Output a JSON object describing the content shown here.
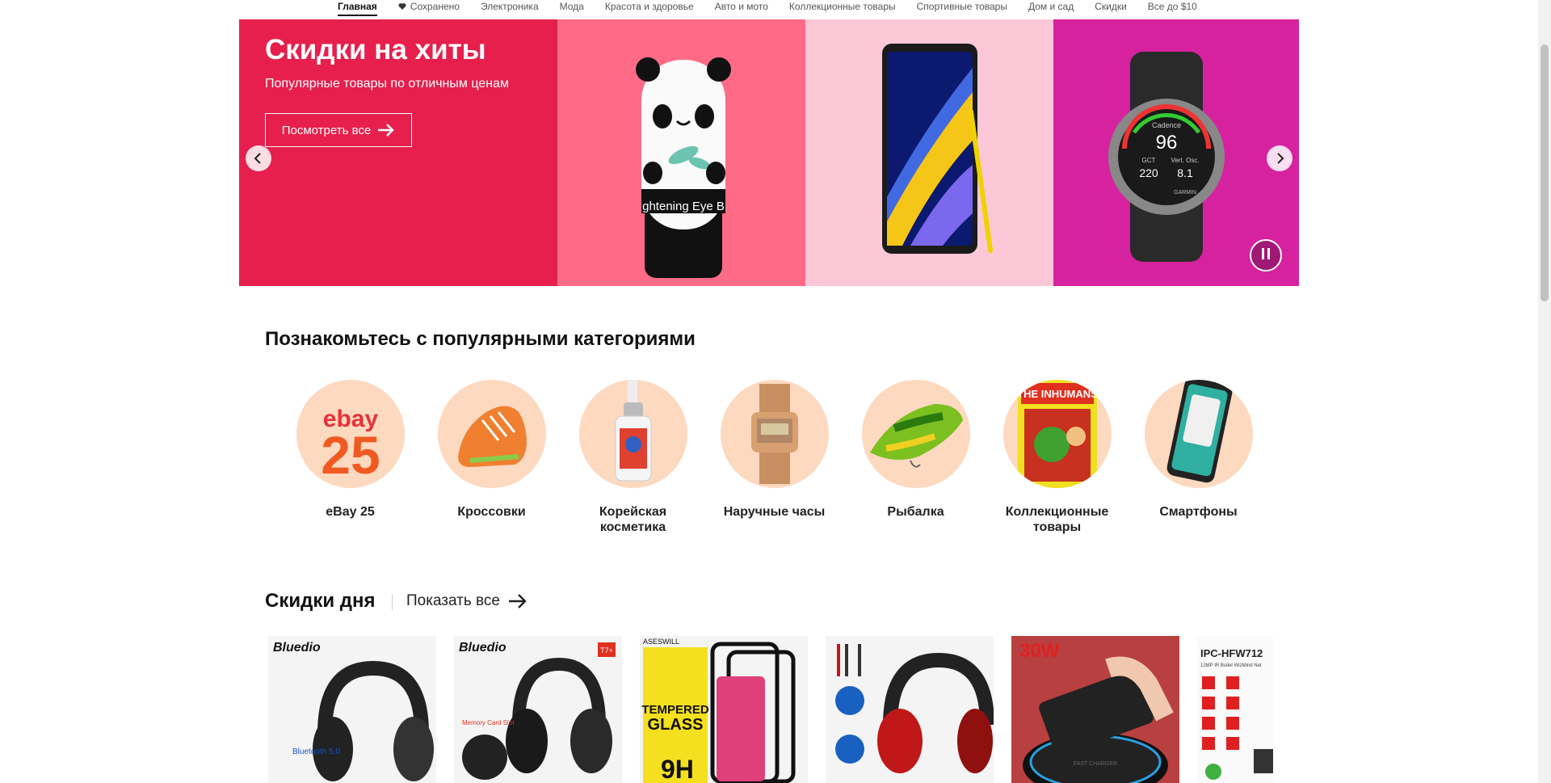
{
  "nav": {
    "items": [
      {
        "label": "Главная",
        "active": true
      },
      {
        "label": "Сохранено",
        "icon": "heart-icon"
      },
      {
        "label": "Электроника"
      },
      {
        "label": "Мода"
      },
      {
        "label": "Красота и здоровье"
      },
      {
        "label": "Авто и мото"
      },
      {
        "label": "Коллекционные товары"
      },
      {
        "label": "Спортивные товары"
      },
      {
        "label": "Дом и сад"
      },
      {
        "label": "Скидки"
      },
      {
        "label": "Все до $10"
      }
    ]
  },
  "hero": {
    "title": "Скидки на хиты",
    "subtitle": "Популярные товары по отличным ценам",
    "button_label": "Посмотреть все",
    "eye_text": "ghtening Eye B",
    "watch_cadence_label": "Cadence",
    "watch_cadence_value": "96",
    "watch_left_value": "220",
    "watch_right_value": "8.1",
    "watch_gct": "GCT",
    "watch_vert": "Vert. Osc.",
    "watch_brand": "GARMIN",
    "colors": {
      "panel1": "#e61f4c",
      "panel2": "#ff6b87",
      "panel3": "#fcc8d8",
      "panel4": "#d6229e"
    }
  },
  "categories": {
    "title": "Познакомьтесь с популярными категориями",
    "items": [
      {
        "label": "eBay 25",
        "icon": "ebay-25-icon",
        "logo_top": "ebay",
        "logo_num": "25"
      },
      {
        "label": "Кроссовки",
        "icon": "sneaker-icon"
      },
      {
        "label": "Корейская косметика",
        "icon": "serum-bottle-icon"
      },
      {
        "label": "Наручные часы",
        "icon": "wristwatch-icon"
      },
      {
        "label": "Рыбалка",
        "icon": "fishing-lure-icon"
      },
      {
        "label": "Коллекционные товары",
        "icon": "comic-book-icon",
        "comic_text": "THE INHUMANS"
      },
      {
        "label": "Смартфоны",
        "icon": "smartphone-icon"
      }
    ]
  },
  "deals": {
    "title": "Скидки дня",
    "show_all": "Показать все",
    "products": [
      {
        "brand": "Bluedio",
        "badge": "Bluetooth 5.0"
      },
      {
        "brand": "Bluedio",
        "tag": "Memory Card Slot",
        "badge": "T7+"
      },
      {
        "brand": "ASESWILL",
        "text1": "TEMPERED",
        "text2": "GLASS",
        "text3": "9H"
      },
      {
        "brand": ""
      },
      {
        "brand": "",
        "badge": "30W",
        "text1": "FAST CHARGER"
      },
      {
        "brand": "IPC-HFW712",
        "text1": "12MP IR Bullet WizMind Net"
      }
    ]
  }
}
